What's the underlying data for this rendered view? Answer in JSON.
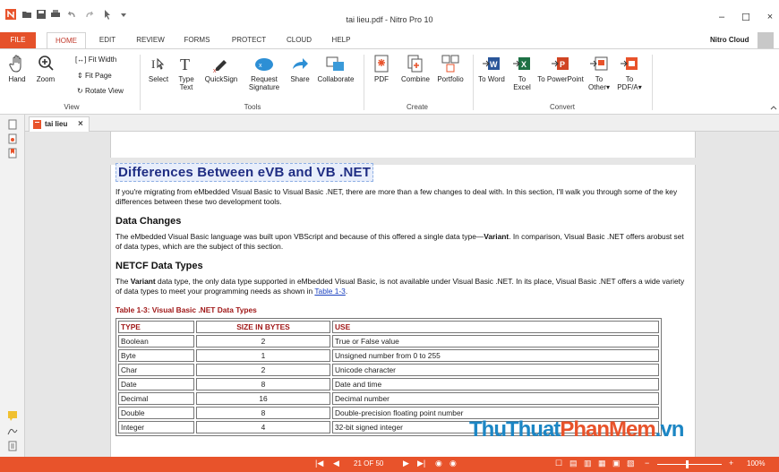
{
  "window": {
    "title": "tai lieu.pdf - Nitro Pro 10",
    "minimize": "–",
    "maximize": "☐",
    "close": "×"
  },
  "ribbon_tabs": [
    "FILE",
    "HOME",
    "EDIT",
    "REVIEW",
    "FORMS",
    "PROTECT",
    "CLOUD",
    "HELP"
  ],
  "account": {
    "name": "Nitro Cloud"
  },
  "ribbon": {
    "view": {
      "hand": "Hand",
      "zoom": "Zoom",
      "fit_width": "Fit Width",
      "fit_page": "Fit Page",
      "rotate_view": "Rotate View",
      "group": "View"
    },
    "tools": {
      "select": "Select",
      "type_text": "Type Text",
      "quicksign": "QuickSign",
      "request_signature": "Request Signature",
      "share": "Share",
      "collaborate": "Collaborate",
      "group": "Tools"
    },
    "create": {
      "pdf": "PDF",
      "combine": "Combine",
      "portfolio": "Portfolio",
      "group": "Create"
    },
    "convert": {
      "to_word": "To Word",
      "to_excel": "To Excel",
      "to_powerpoint": "To PowerPoint",
      "to_other": "To Other▾",
      "to_pdfa": "To PDF/A▾",
      "group": "Convert"
    }
  },
  "doc_tab": {
    "label": "tai lieu",
    "close": "×"
  },
  "document": {
    "title": "Differences Between eVB and VB .NET",
    "intro": "If you're migrating from eMbedded Visual Basic to Visual Basic .NET, there are more than a few changes to deal with. In this section, I'll walk you through some of the key differences between these two development tools.",
    "h_data_changes": "Data Changes",
    "p_data_changes_a": "The eMbedded Visual Basic language was built upon VBScript and because of this offered a single data type—",
    "p_data_changes_bold": "Variant",
    "p_data_changes_b": ". In comparison, Visual Basic .NET offers arobust set of data types, which are the subject of this section.",
    "h_netcf": "NETCF Data Types",
    "p_netcf_a": "The ",
    "p_netcf_bold": "Variant",
    "p_netcf_b": " data type, the only data type supported in eMbedded Visual Basic, is not available under Visual Basic .NET. In its place, Visual Basic .NET offers a wide variety of data types to meet your programming needs as shown in ",
    "p_netcf_link": "Table 1-3",
    "p_netcf_end": ".",
    "table_caption": "Table 1-3: Visual Basic .NET Data Types",
    "table_headers": [
      "TYPE",
      "SIZE IN BYTES",
      "USE"
    ],
    "table_rows": [
      [
        "Boolean",
        "2",
        "True or False value"
      ],
      [
        "Byte",
        "1",
        "Unsigned number from 0 to 255"
      ],
      [
        "Char",
        "2",
        "Unicode character"
      ],
      [
        "Date",
        "8",
        "Date and time"
      ],
      [
        "Decimal",
        "16",
        "Decimal number"
      ],
      [
        "Double",
        "8",
        "Double-precision floating point number"
      ],
      [
        "Integer",
        "4",
        "32-bit signed integer"
      ]
    ]
  },
  "status": {
    "page": "21 OF 50",
    "zoom": "100%"
  },
  "watermark": {
    "part1": "ThuThuat",
    "part2": "PhanMem",
    "part3": ".vn"
  },
  "colors": {
    "accent": "#e8532b",
    "title_blue": "#1f2d83",
    "caption_red": "#a01818"
  }
}
